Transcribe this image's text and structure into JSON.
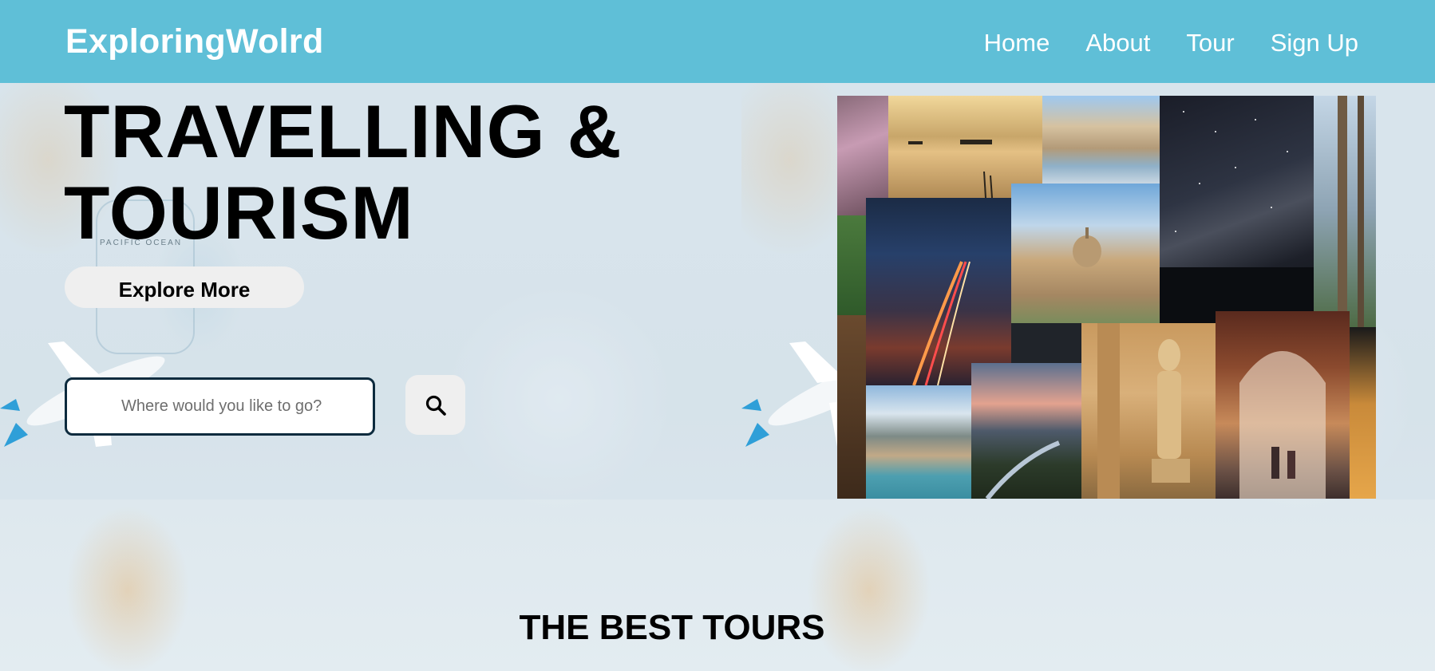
{
  "header": {
    "brand": "ExploringWolrd",
    "nav": [
      {
        "label": "Home"
      },
      {
        "label": "About"
      },
      {
        "label": "Tour"
      },
      {
        "label": "Sign Up"
      }
    ]
  },
  "hero": {
    "title_line1": "TRAVELLING &",
    "title_line2": "TOURISM",
    "explore_button": "Explore More",
    "search": {
      "placeholder": "Where would you like to go?",
      "value": ""
    },
    "search_button_icon": "search-icon"
  },
  "background": {
    "map_label": "PACIFIC OCEAN"
  },
  "section": {
    "title": "THE BEST TOURS"
  },
  "colors": {
    "navbar": "#5fbfd7",
    "brand_text": "#ffffff",
    "search_border": "#0d2b3e",
    "button_bg": "#efefef"
  }
}
